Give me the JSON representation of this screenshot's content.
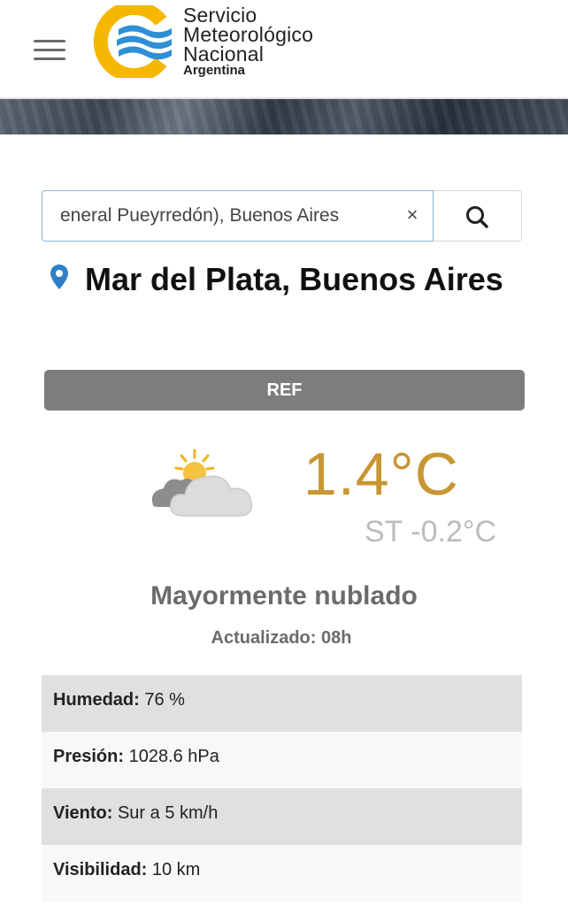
{
  "header": {
    "menu_icon": "hamburger-menu-icon",
    "logo_icon": "smn-logo-icon",
    "logo_lines": [
      "Servicio",
      "Meteorológico",
      "Nacional",
      "Argentina"
    ],
    "colors": {
      "logo_yellow": "#f5b700",
      "logo_blue": "#2f8fd6"
    }
  },
  "search": {
    "value": "eneral Pueyrredón), Buenos Aires",
    "clear_icon": "close-icon",
    "clear_label": "×",
    "button_icon": "search-icon"
  },
  "location": {
    "icon": "map-pin-icon",
    "name": "Mar del Plata, Buenos Aires"
  },
  "ref_label": "REF",
  "current": {
    "icon": "partly-cloudy-icon",
    "temperature": "1.4°C",
    "feels_like": "ST -0.2°C",
    "condition": "Mayormente nublado",
    "updated": "Actualizado: 08h",
    "colors": {
      "temperature": "#c89632"
    }
  },
  "details": [
    {
      "label": "Humedad:",
      "value": "76 %"
    },
    {
      "label": "Presión:",
      "value": "1028.6 hPa"
    },
    {
      "label": "Viento:",
      "value": "Sur a 5 km/h"
    },
    {
      "label": "Visibilidad:",
      "value": "10 km"
    }
  ]
}
